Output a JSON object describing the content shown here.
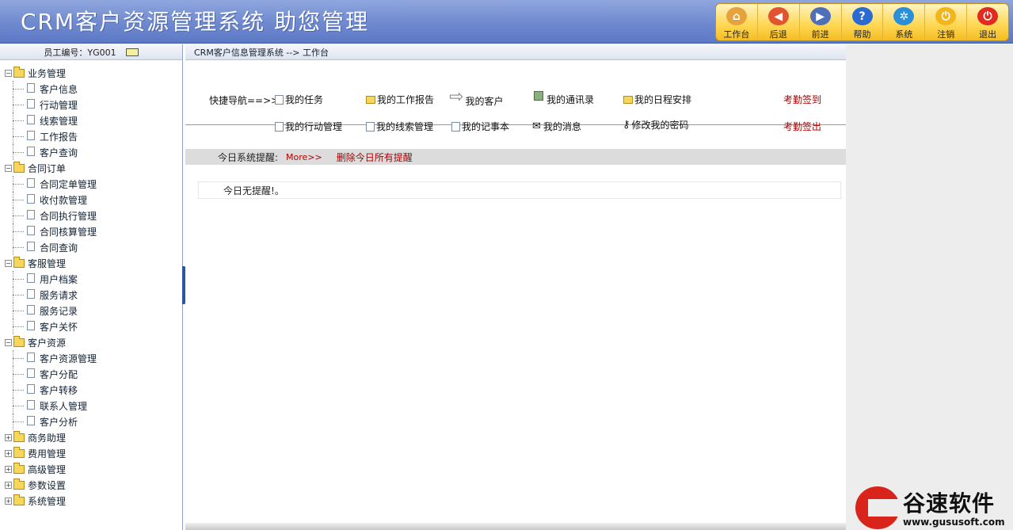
{
  "header": {
    "title": "CRM客户资源管理系统  助您管理",
    "toolbar": [
      {
        "label": "工作台",
        "icon": "home-icon",
        "color": "#e6a23c"
      },
      {
        "label": "后退",
        "icon": "back-icon",
        "color": "#e2532f"
      },
      {
        "label": "前进",
        "icon": "forward-icon",
        "color": "#4f6fb8"
      },
      {
        "label": "帮助",
        "icon": "help-icon",
        "color": "#2b6ad0"
      },
      {
        "label": "系统",
        "icon": "gear-icon",
        "color": "#2b8fd8"
      },
      {
        "label": "注销",
        "icon": "power-icon",
        "color": "#f2b51a"
      },
      {
        "label": "退出",
        "icon": "exit-icon",
        "color": "#e02b20"
      }
    ]
  },
  "sidebar": {
    "employee": "员工编号：YG001",
    "groups": [
      {
        "label": "业务管理",
        "expanded": true,
        "items": [
          "客户信息",
          "行动管理",
          "线索管理",
          "工作报告",
          "客户查询"
        ]
      },
      {
        "label": "合同订单",
        "expanded": true,
        "items": [
          "合同定单管理",
          "收付款管理",
          "合同执行管理",
          "合同核算管理",
          "合同查询"
        ]
      },
      {
        "label": "客服管理",
        "expanded": true,
        "items": [
          "用户档案",
          "服务请求",
          "服务记录",
          "客户关怀"
        ]
      },
      {
        "label": "客户资源",
        "expanded": true,
        "items": [
          "客户资源管理",
          "客户分配",
          "客户转移",
          "联系人管理",
          "客户分析"
        ]
      },
      {
        "label": "商务助理",
        "expanded": false,
        "items": []
      },
      {
        "label": "费用管理",
        "expanded": false,
        "items": []
      },
      {
        "label": "高级管理",
        "expanded": false,
        "items": []
      },
      {
        "label": "参数设置",
        "expanded": false,
        "items": []
      },
      {
        "label": "系统管理",
        "expanded": false,
        "items": []
      }
    ]
  },
  "main": {
    "breadcrumb": "CRM客户信息管理系统 --> 工作台",
    "quicknav_label": "快捷导航==>>",
    "quicknav": {
      "my_tasks": "我的任务",
      "my_work_report": "我的工作报告",
      "my_customers": "我的客户",
      "my_contacts": "我的通讯录",
      "my_schedule": "我的日程安排",
      "checkin": "考勤签到",
      "my_actions": "我的行动管理",
      "my_leads": "我的线索管理",
      "my_notes": "我的记事本",
      "my_messages": "我的消息",
      "change_password": "修改我的密码",
      "checkout": "考勤签出"
    },
    "alert": {
      "label": "今日系统提醒:",
      "more": "More>>",
      "delete_all": "删除今日所有提醒",
      "empty": "今日无提醒!。"
    }
  },
  "brand": {
    "logo_text": "谷速软件",
    "url": "www.gususoft.com"
  }
}
